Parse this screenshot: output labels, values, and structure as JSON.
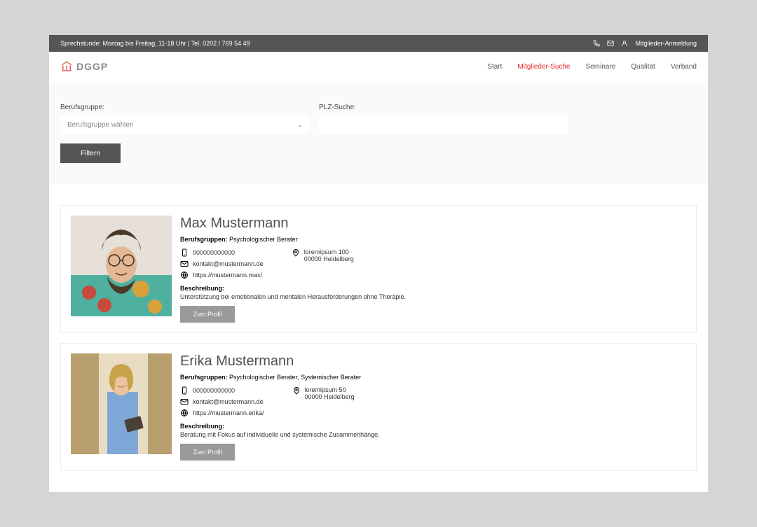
{
  "topbar": {
    "hours": "Sprechstunde: Montag bis Freitag, 11-18 Uhr | Tel. 0202 / 769 54 49",
    "login_label": "Mitglieder-Anmeldung"
  },
  "logo": {
    "text": "DGGP"
  },
  "nav": {
    "items": [
      "Start",
      "Mitglieder-Suche",
      "Seminare",
      "Qualität",
      "Verband"
    ],
    "active_index": 1
  },
  "filter": {
    "group_label": "Berufsgruppe:",
    "group_placeholder": "Berufsgruppe wählen",
    "plz_label": "PLZ-Suche:",
    "button": "Filtern"
  },
  "labels": {
    "berufs_prefix": "Berufsgruppen:",
    "desc_prefix": "Beschreibung:",
    "profile_btn": "Zum Profil"
  },
  "members": [
    {
      "name": "Max Mustermann",
      "groups": "Psychologischer Berater",
      "phone": "000000000000",
      "email": "kontakt@mustermann.de",
      "website": "https://mustermann.max/",
      "address_line1": "loremipsum 100",
      "address_line2": "00000 Heidelberg",
      "description": "Unterstützung bei emotionalen und mentalen Herausforderungen ohne Therapie."
    },
    {
      "name": "Erika Mustermann",
      "groups": "Psychologischer Berater, Systemischer Berater",
      "phone": "000000000000",
      "email": "kontakt@mustermann.de",
      "website": "https://mustermann.erika/",
      "address_line1": "loremipsum 50",
      "address_line2": "00000 Heidelberg",
      "description": "Beratung mit Fokus auf individuelle und systemische Zusammenhänge."
    }
  ]
}
